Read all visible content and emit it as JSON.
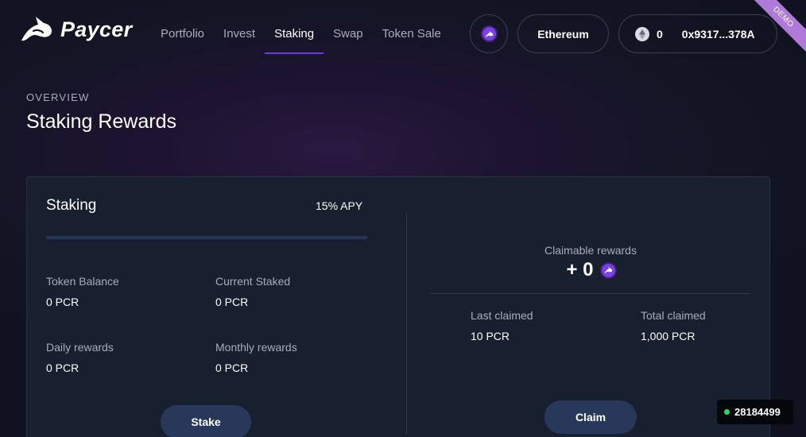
{
  "brand": {
    "name": "Paycer"
  },
  "nav": {
    "items": [
      {
        "label": "Portfolio"
      },
      {
        "label": "Invest"
      },
      {
        "label": "Staking"
      },
      {
        "label": "Swap"
      },
      {
        "label": "Token Sale"
      }
    ],
    "active": "Staking"
  },
  "header": {
    "token_icon": "paycer-token-icon",
    "network": "Ethereum",
    "wallet": {
      "balance": "0",
      "address": "0x9317...378A",
      "icon": "ethereum-icon"
    },
    "ribbon": "DEMO"
  },
  "page": {
    "overline": "OVERVIEW",
    "title": "Staking Rewards"
  },
  "staking": {
    "title": "Staking",
    "apy": "15% APY",
    "progress": 0,
    "token_balance": {
      "label": "Token Balance",
      "value": "0 PCR"
    },
    "current_staked": {
      "label": "Current Staked",
      "value": "0 PCR"
    },
    "daily_rewards": {
      "label": "Daily rewards",
      "value": "0 PCR"
    },
    "monthly_rewards": {
      "label": "Monthly rewards",
      "value": "0 PCR"
    },
    "stake_button": "Stake"
  },
  "rewards": {
    "claimable_label": "Claimable rewards",
    "claimable_value": "+ 0",
    "last_claimed": {
      "label": "Last claimed",
      "value": "10 PCR"
    },
    "total_claimed": {
      "label": "Total claimed",
      "value": "1,000 PCR"
    },
    "claim_button": "Claim"
  },
  "status": {
    "block_number": "28184499",
    "indicator_color": "#2fd36b"
  },
  "colors": {
    "accent": "#6c3ad9",
    "button": "#27385a",
    "card": "#18202f"
  }
}
